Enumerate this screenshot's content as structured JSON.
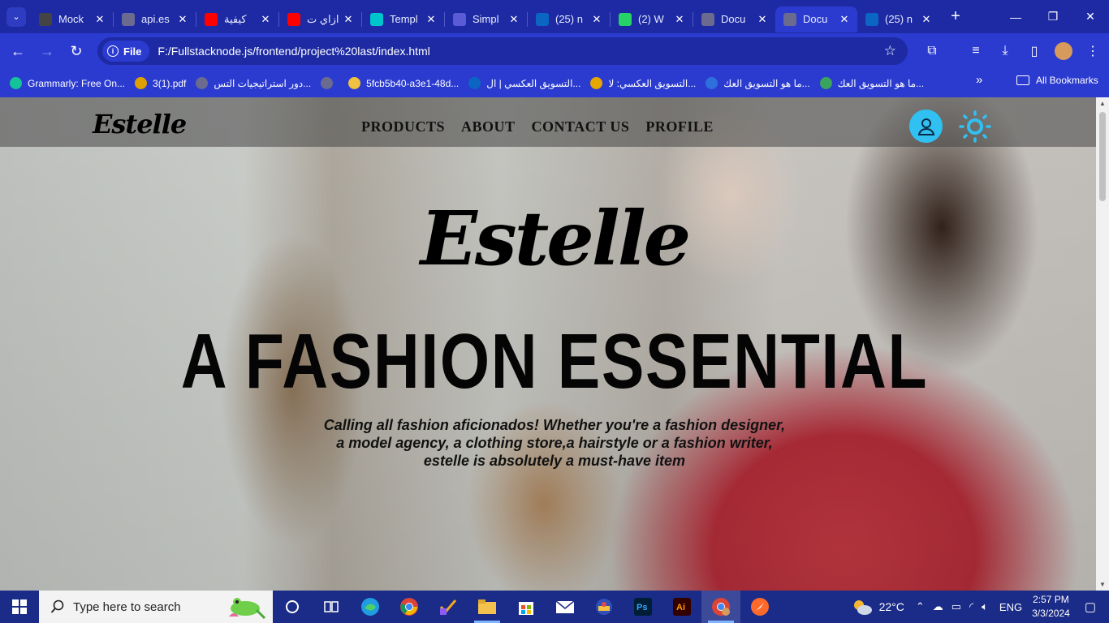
{
  "browser": {
    "tabs": [
      {
        "title": "Mock",
        "icon": "mock-icon",
        "color": "#444"
      },
      {
        "title": "api.es",
        "icon": "globe-icon",
        "color": "#6b6b8f"
      },
      {
        "title": "كيفية",
        "icon": "youtube-icon",
        "color": "#ff0000"
      },
      {
        "title": "ازاي ت",
        "icon": "youtube-icon",
        "color": "#ff0000"
      },
      {
        "title": "Templ",
        "icon": "canva-icon",
        "color": "#00c4cc"
      },
      {
        "title": "Simpl",
        "icon": "simplilearn-icon",
        "color": "#5b5bd6"
      },
      {
        "title": "(25) n",
        "icon": "linkedin-icon",
        "color": "#0a66c2"
      },
      {
        "title": "(2) W",
        "icon": "whatsapp-icon",
        "color": "#25d366"
      },
      {
        "title": "Docu",
        "icon": "globe-icon",
        "color": "#6b6b8f"
      },
      {
        "title": "Docu",
        "icon": "globe-icon",
        "color": "#6b6b8f",
        "active": true
      },
      {
        "title": "(25) n",
        "icon": "linkedin-icon",
        "color": "#0a66c2"
      }
    ],
    "address": {
      "chip": "File",
      "url": "F:/Fullstacknode.js/frontend/project%20last/index.html"
    },
    "bookmarks": [
      {
        "label": "Grammarly: Free On...",
        "icon": "grammarly-icon",
        "color": "#15c39a"
      },
      {
        "label": "3(1).pdf",
        "icon": "pdf-icon",
        "color": "#e0a100"
      },
      {
        "label": "دور استراتيجيات التس...",
        "icon": "globe-icon",
        "color": "#6b6b8f"
      },
      {
        "label": "",
        "icon": "globe-icon",
        "color": "#6b6b8f"
      },
      {
        "label": "5fcb5b40-a3e1-48d...",
        "icon": "image-icon",
        "color": "#f0c040"
      },
      {
        "label": "التسويق العكسي | ال...",
        "icon": "linkedin-icon",
        "color": "#0a66c2"
      },
      {
        "label": "التسويق العكسي: لا...",
        "icon": "five-icon",
        "color": "#e6a700"
      },
      {
        "label": "ما هو التسويق العك...",
        "icon": "bookmark-site-icon",
        "color": "#2f6fdd"
      },
      {
        "label": "ما هو التسويق العك...",
        "icon": "bookmark-site-icon",
        "color": "#3aa35c"
      }
    ],
    "all_bookmarks": "All Bookmarks"
  },
  "site": {
    "brand": "Estelle",
    "nav": [
      "PRODUCTS",
      "ABOUT",
      "CONTACT US",
      "PROFILE"
    ],
    "hero": {
      "brand": "Estelle",
      "title": "A FASHION ESSENTIAL",
      "lines": [
        "Calling all fashion aficionados! Whether you're a fashion designer,",
        "a model agency, a clothing store,a hairstyle or a fashion writer,",
        "estelle is absolutely a must-have item"
      ]
    },
    "colors": {
      "accent": "#30c0f2"
    }
  },
  "taskbar": {
    "search_placeholder": "Type here to search",
    "weather": "22°C",
    "language": "ENG",
    "time": "2:57 PM",
    "date": "3/3/2024"
  }
}
